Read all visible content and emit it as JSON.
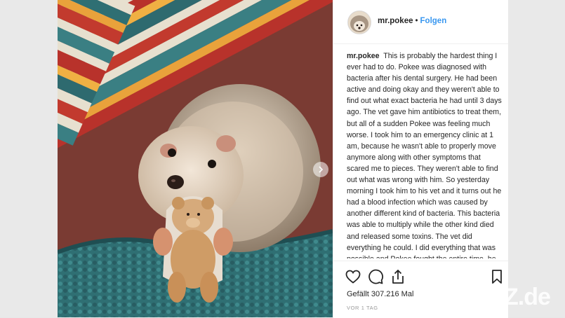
{
  "post": {
    "username": "mr.pokee",
    "separator": "•",
    "follow_label": "Folgen",
    "caption": "This is probably the hardest thing I ever had to do. Pokee was diagnosed with bacteria after his dental surgery. He had been active and doing okay and they weren't able to find out what exact bacteria he had until 3 days ago. The vet gave him antibiotics to treat them, but all of a sudden Pokee was feeling much worse. I took him to an emergency clinic at 1 am, because he wasn't able to properly move anymore along with other symptoms that scared me to pieces. They weren't able to find out what was wrong with him. So yesterday morning I took him to his vet and it turns out he had a blood infection which was caused by another different kind of bacteria. This bacteria was able to multiply while the other kind died and released some toxins. The vet did everything he could. I did everything that was possible and Pokee fought the entire time, he might",
    "likes": "Gefällt 307.216 Mal",
    "time": "VOR 1 TAG"
  },
  "icons": {
    "like": "heart-icon",
    "comment": "comment-icon",
    "share": "share-icon",
    "save": "bookmark-icon",
    "next": "chevron-right-icon"
  },
  "watermark": "Z.de",
  "colors": {
    "link": "#3897f0",
    "text": "#262626",
    "muted": "#999999"
  }
}
